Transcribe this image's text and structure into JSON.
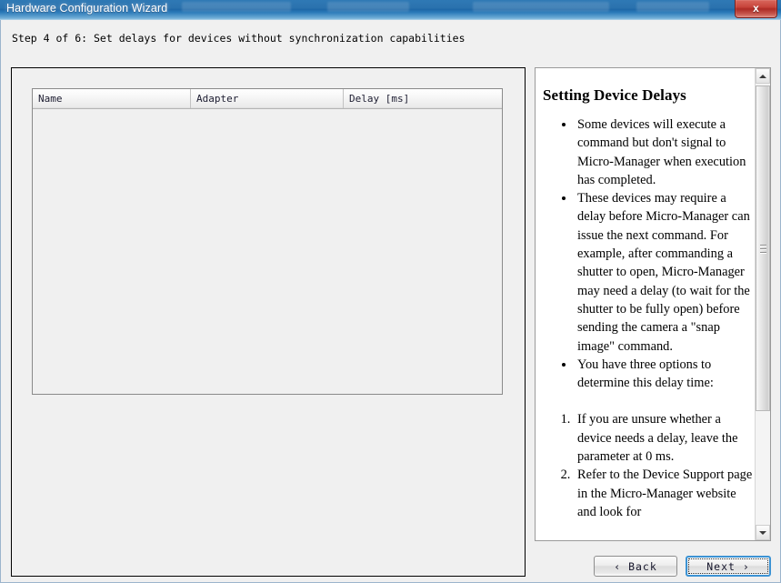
{
  "window": {
    "title": "Hardware Configuration Wizard",
    "close_label": "x"
  },
  "step": {
    "label": "Step 4 of 6: Set delays for devices without synchronization capabilities"
  },
  "table": {
    "columns": [
      "Name",
      "Adapter",
      "Delay [ms]"
    ],
    "rows": []
  },
  "help": {
    "title": "Setting Device Delays",
    "bullets": [
      "Some devices will execute a command but don't signal to Micro-Manager when execution has completed.",
      "These devices may require a delay before Micro-Manager can issue the next command. For example, after commanding a shutter to open, Micro-Manager may need a delay (to wait for the shutter to be fully open) before sending the camera a \"snap image\" command.",
      "You have three options to determine this delay time:"
    ],
    "numbered": [
      "If you are unsure whether a device needs a delay, leave the parameter at 0 ms.",
      "Refer to the Device Support page in the Micro-Manager website and look for"
    ]
  },
  "buttons": {
    "back": "‹ Back",
    "next": "Next ›"
  },
  "colors": {
    "titlebar_blue": "#2b72ae",
    "close_red": "#c8453c",
    "focus_blue": "#3c93d4",
    "panel_gray": "#f0f0f0"
  }
}
